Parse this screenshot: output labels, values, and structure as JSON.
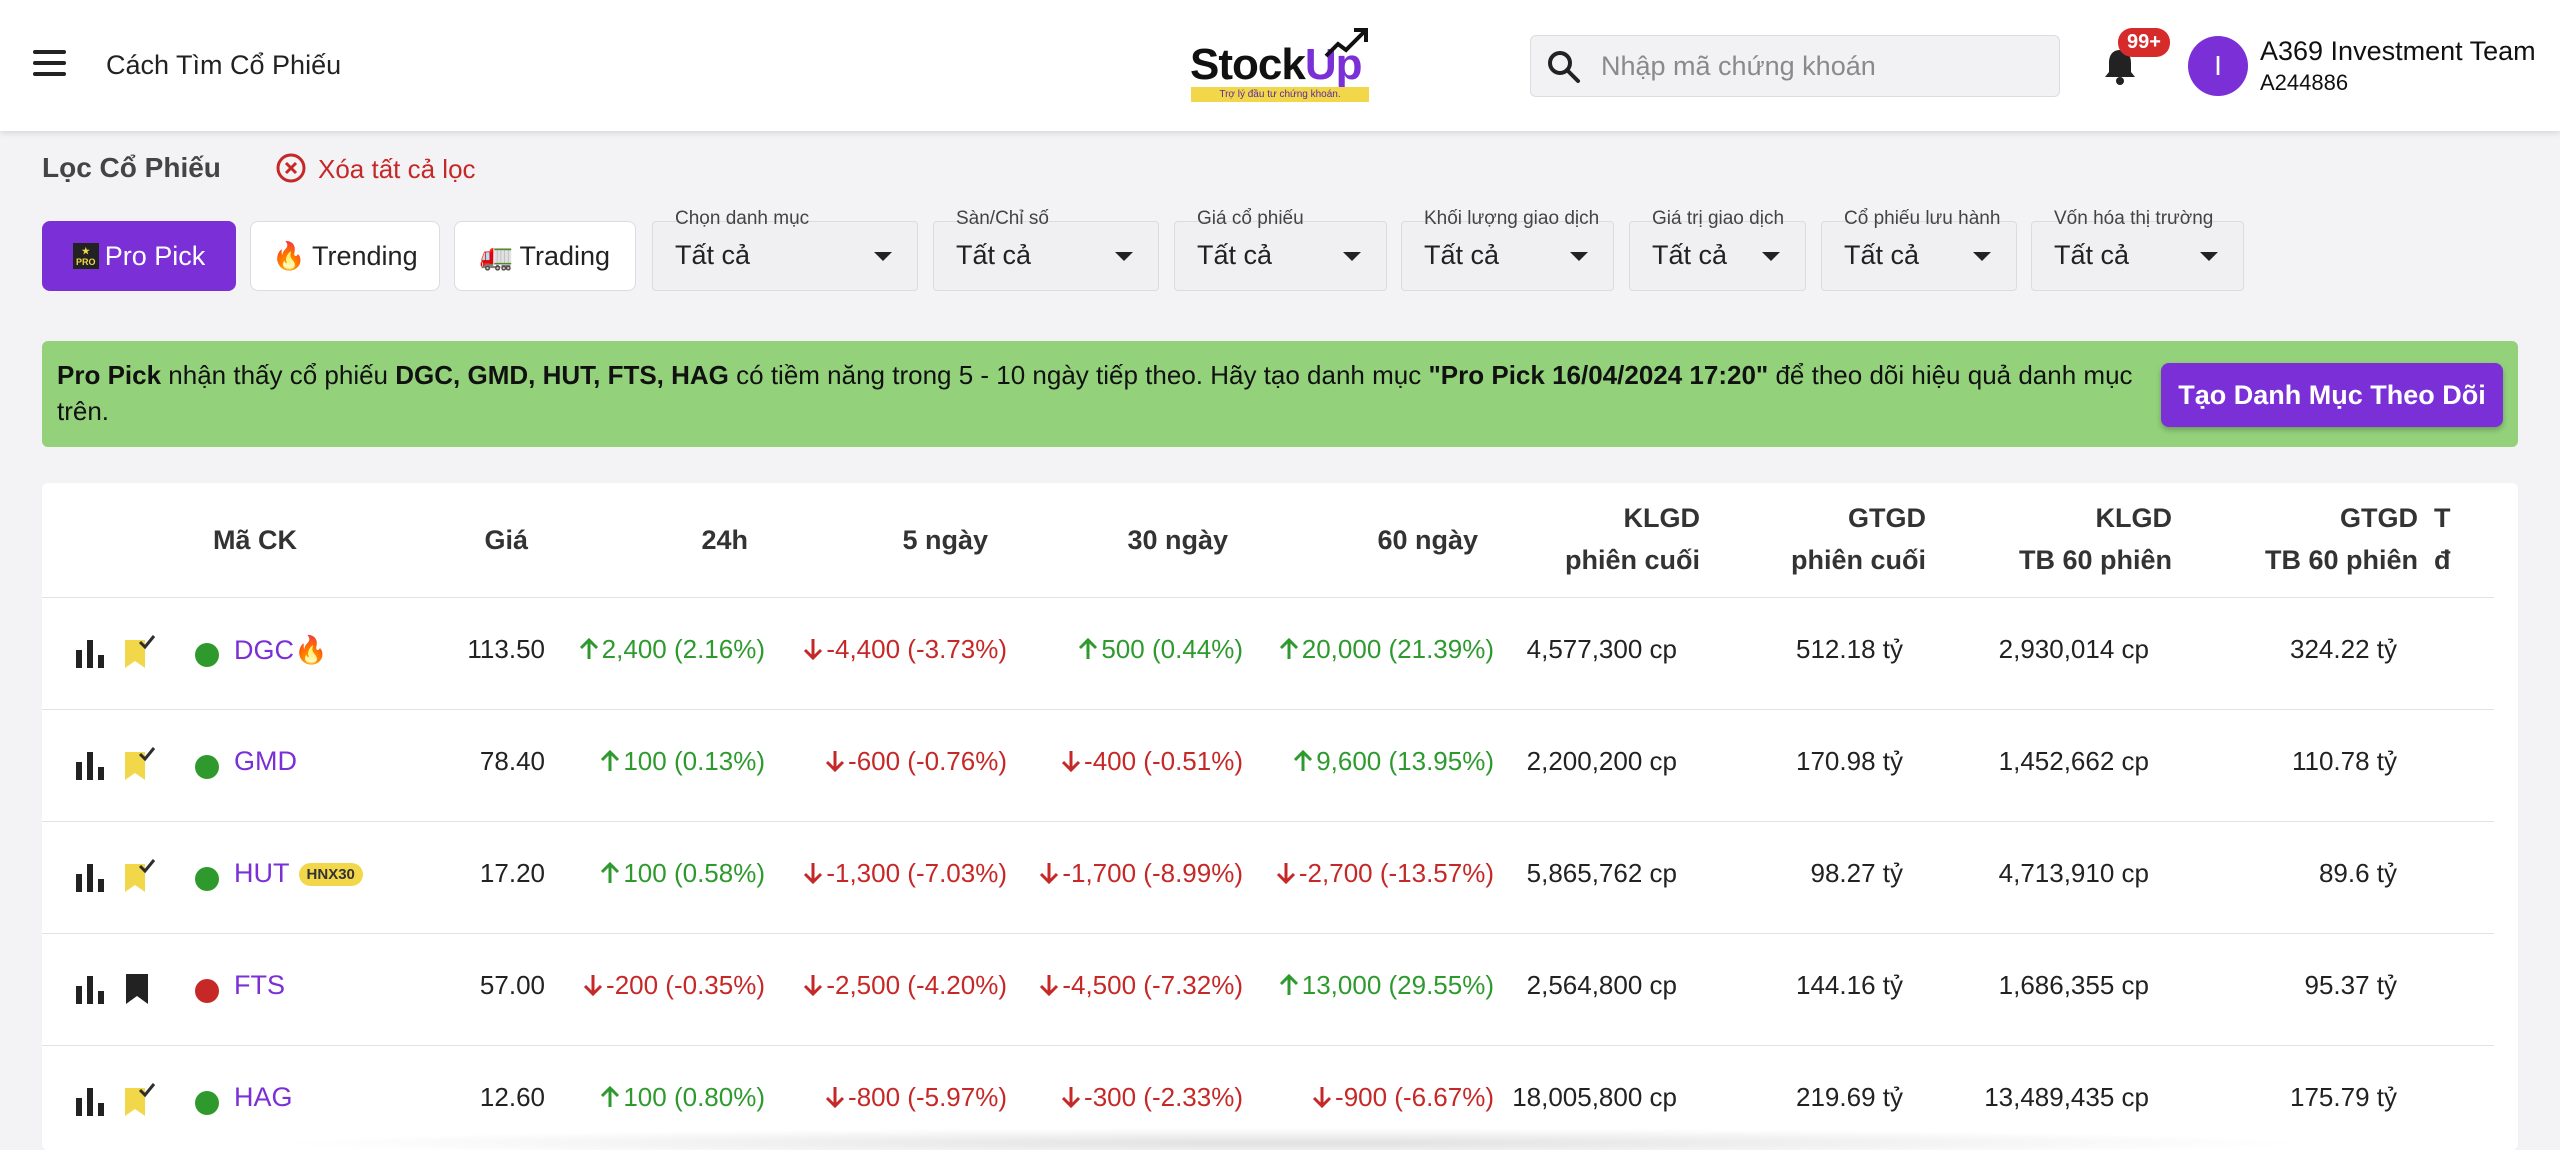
{
  "header": {
    "page_name": "Cách Tìm Cổ Phiếu",
    "logo_text_main": "Stock",
    "logo_text_accent": "Up",
    "logo_tagline": "Trợ lý đầu tư chứng khoán.",
    "search_placeholder": "Nhập mã chứng khoán",
    "notification_count": "99+",
    "avatar_letter": "I",
    "user_name": "A369 Investment Team",
    "user_id": "A244886"
  },
  "filters": {
    "title": "Lọc Cổ Phiếu",
    "clear_label": "Xóa tất cả lọc",
    "tabs": [
      {
        "label": "Pro Pick",
        "icon": "pro-icon",
        "active": true
      },
      {
        "label": "Trending",
        "icon": "🔥",
        "active": false
      },
      {
        "label": "Trading",
        "icon": "🚛",
        "active": false
      }
    ],
    "dropdowns": [
      {
        "label": "Chọn danh mục",
        "value": "Tất cả"
      },
      {
        "label": "Sàn/Chỉ số",
        "value": "Tất cả"
      },
      {
        "label": "Giá cổ phiếu",
        "value": "Tất cả"
      },
      {
        "label": "Khối lượng giao dịch",
        "value": "Tất cả"
      },
      {
        "label": "Giá trị giao dịch",
        "value": "Tất cả"
      },
      {
        "label": "Cổ phiếu lưu hành",
        "value": "Tất cả"
      },
      {
        "label": "Vốn hóa thị trường",
        "value": "Tất cả"
      }
    ]
  },
  "banner": {
    "part1": "Pro Pick",
    "part2": " nhận thấy cổ phiếu ",
    "tickers": "DGC, GMD, HUT, FTS, HAG",
    "part3": " có tiềm năng trong 5 - 10 ngày tiếp theo. Hãy tạo danh mục ",
    "portfolio_name": "\"Pro Pick 16/04/2024 17:20\"",
    "part4": " để theo dõi hiệu quả danh mục trên.",
    "button_label": "Tạo Danh Mục Theo Dõi"
  },
  "table": {
    "headers": {
      "ticker": "Mã CK",
      "price": "Giá",
      "h24": "24h",
      "d5": "5 ngày",
      "d30": "30 ngày",
      "d60": "60 ngày",
      "klgd_last_1": "KLGD",
      "klgd_last_2": "phiên cuối",
      "gtgd_last_1": "GTGD",
      "gtgd_last_2": "phiên cuối",
      "klgd_avg_1": "KLGD",
      "klgd_avg_2": "TB 60 phiên",
      "gtgd_avg_1": "GTGD",
      "gtgd_avg_2": "TB 60 phiên",
      "extra_1": "T",
      "extra_2": "đ"
    },
    "rows": [
      {
        "ticker": "DGC",
        "fire": "🔥",
        "badge": "",
        "status": "green",
        "watched": true,
        "price": "113.50",
        "h24": {
          "dir": "up",
          "text": "2,400 (2.16%)"
        },
        "d5": {
          "dir": "down",
          "text": "-4,400 (-3.73%)"
        },
        "d30": {
          "dir": "up",
          "text": "500 (0.44%)"
        },
        "d60": {
          "dir": "up",
          "text": "20,000 (21.39%)"
        },
        "klgd_last": "4,577,300 cp",
        "gtgd_last": "512.18 tỷ",
        "klgd_avg": "2,930,014 cp",
        "gtgd_avg": "324.22 tỷ"
      },
      {
        "ticker": "GMD",
        "fire": "",
        "badge": "",
        "status": "green",
        "watched": true,
        "price": "78.40",
        "h24": {
          "dir": "up",
          "text": "100 (0.13%)"
        },
        "d5": {
          "dir": "down",
          "text": "-600 (-0.76%)"
        },
        "d30": {
          "dir": "down",
          "text": "-400 (-0.51%)"
        },
        "d60": {
          "dir": "up",
          "text": "9,600 (13.95%)"
        },
        "klgd_last": "2,200,200 cp",
        "gtgd_last": "170.98 tỷ",
        "klgd_avg": "1,452,662 cp",
        "gtgd_avg": "110.78 tỷ"
      },
      {
        "ticker": "HUT",
        "fire": "",
        "badge": "HNX30",
        "status": "green",
        "watched": true,
        "price": "17.20",
        "h24": {
          "dir": "up",
          "text": "100 (0.58%)"
        },
        "d5": {
          "dir": "down",
          "text": "-1,300 (-7.03%)"
        },
        "d30": {
          "dir": "down",
          "text": "-1,700 (-8.99%)"
        },
        "d60": {
          "dir": "down",
          "text": "-2,700 (-13.57%)"
        },
        "klgd_last": "5,865,762 cp",
        "gtgd_last": "98.27 tỷ",
        "klgd_avg": "4,713,910 cp",
        "gtgd_avg": "89.6 tỷ"
      },
      {
        "ticker": "FTS",
        "fire": "",
        "badge": "",
        "status": "red",
        "watched": false,
        "price": "57.00",
        "h24": {
          "dir": "down",
          "text": "-200 (-0.35%)"
        },
        "d5": {
          "dir": "down",
          "text": "-2,500 (-4.20%)"
        },
        "d30": {
          "dir": "down",
          "text": "-4,500 (-7.32%)"
        },
        "d60": {
          "dir": "up",
          "text": "13,000 (29.55%)"
        },
        "klgd_last": "2,564,800 cp",
        "gtgd_last": "144.16 tỷ",
        "klgd_avg": "1,686,355 cp",
        "gtgd_avg": "95.37 tỷ"
      },
      {
        "ticker": "HAG",
        "fire": "",
        "badge": "",
        "status": "green",
        "watched": true,
        "price": "12.60",
        "h24": {
          "dir": "up",
          "text": "100 (0.80%)"
        },
        "d5": {
          "dir": "down",
          "text": "-800 (-5.97%)"
        },
        "d30": {
          "dir": "down",
          "text": "-300 (-2.33%)"
        },
        "d60": {
          "dir": "down",
          "text": "-900 (-6.67%)"
        },
        "klgd_last": "18,005,800 cp",
        "gtgd_last": "219.69 tỷ",
        "klgd_avg": "13,489,435 cp",
        "gtgd_avg": "175.79 tỷ"
      }
    ]
  },
  "colors": {
    "brand": "#7b2fd6",
    "up": "#2e9a2e",
    "down": "#c62828",
    "banner_bg": "#93d27b",
    "watch_yellow": "#f2d74a"
  }
}
